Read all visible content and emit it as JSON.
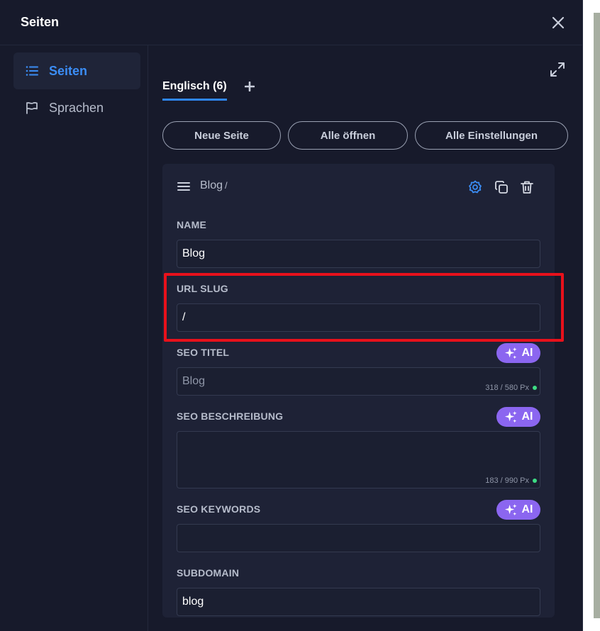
{
  "modal": {
    "title": "Seiten"
  },
  "sidebar": {
    "items": [
      {
        "label": "Seiten",
        "icon": "list-icon",
        "active": true
      },
      {
        "label": "Sprachen",
        "icon": "flag-icon",
        "active": false
      }
    ]
  },
  "tabs": [
    {
      "label": "Englisch (6)",
      "active": true
    }
  ],
  "actions": {
    "new_page": "Neue Seite",
    "open_all": "Alle öffnen",
    "all_settings": "Alle Einstellungen"
  },
  "page": {
    "breadcrumb": "Blog",
    "breadcrumb_suffix": "/",
    "fields": {
      "name": {
        "label": "NAME",
        "value": "Blog"
      },
      "url_slug": {
        "label": "URL SLUG",
        "value": "/"
      },
      "seo_title": {
        "label": "SEO TITEL",
        "placeholder": "Blog",
        "counter": "318 / 580 Px"
      },
      "seo_description": {
        "label": "SEO BESCHREIBUNG",
        "value": "",
        "counter": "183 / 990 Px"
      },
      "seo_keywords": {
        "label": "SEO KEYWORDS",
        "value": ""
      },
      "subdomain": {
        "label": "SUBDOMAIN",
        "value": "blog"
      }
    },
    "ai_label": "AI"
  },
  "colors": {
    "accent": "#3b8df5",
    "ai_purple": "#8b66f0",
    "highlight_red": "#e8111b",
    "status_green": "#3ddc84"
  }
}
